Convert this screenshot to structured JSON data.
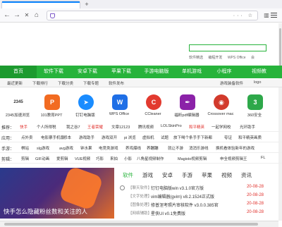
{
  "browser": {
    "new_tab_symbol": "+",
    "back": "←",
    "forward": "→",
    "close": "✕",
    "home": "⌂",
    "url_tools": "··· ☆",
    "address": ""
  },
  "search": {
    "placeholder": "",
    "links": [
      "软件精选",
      "编程开发",
      "WPS Office",
      "会"
    ]
  },
  "main_nav": [
    "首页",
    "软件下载",
    "安卓下载",
    "苹果下载",
    "手游电脑版",
    "单机游戏",
    "小程序",
    "视频教"
  ],
  "sub_nav": [
    "最近更新",
    "下载排行",
    "下载分类",
    "下载专题",
    "软件发布",
    "游戏装备软件",
    "logo"
  ],
  "apps": [
    {
      "label": "2345加速浏览",
      "icon": "2345-browser-icon",
      "glyph": "2345",
      "color": "#ffffff"
    },
    {
      "label": "101教育PPT",
      "icon": "ppt-icon",
      "glyph": "P",
      "color": "#f26b21"
    },
    {
      "label": "钉钉电脑版",
      "icon": "dingtalk-icon",
      "glyph": "➤",
      "color": "#1a8cff"
    },
    {
      "label": "WPS Office",
      "icon": "wps-icon",
      "glyph": "W",
      "color": "#1f6fe6"
    },
    {
      "label": "CCleaner",
      "icon": "ccleaner-icon",
      "glyph": "C",
      "color": "#e23a2f"
    },
    {
      "label": "福昕pdf编辑器",
      "icon": "foxit-icon",
      "glyph": "✒",
      "color": "#8b22a8"
    },
    {
      "label": "Crossover mac",
      "icon": "crossover-icon",
      "glyph": "◉",
      "color": "#d23a2c"
    },
    {
      "label": "360安全",
      "icon": "360-icon",
      "glyph": "3",
      "color": "#2ea84a"
    }
  ],
  "categories": {
    "recommend": {
      "head": "推荐：",
      "items": [
        "快手",
        "个人所得税",
        "我之谷7",
        "王者荣耀",
        "文章12123",
        "腾讯视频",
        "LOLSkinPro",
        "和平精英",
        "一起学网校",
        "光环助手"
      ]
    },
    "apps_row": {
      "head": "应用：",
      "items": [
        "点外卖",
        "电影票手机版",
        "修本",
        "游戏助手",
        "游戏双开",
        "pi 浏览",
        "虚拟机",
        "试题",
        "旅下喝个条手手下新都",
        "夸证",
        "和平精英画质"
      ]
    },
    "games_row": {
      "head": "手游：",
      "items": [
        "棋站",
        "slg游戏",
        "avg游戏",
        "钟水果",
        "电竞类游戏",
        "养鸡爆线",
        "养蹦蹦",
        "就让不游",
        "消消乐游线",
        "换机看体验新年的游戏"
      ]
    },
    "edit_row": {
      "head": "剪辑：",
      "items": [
        "剪辑",
        "GIF动画",
        "爱剪辑",
        "VUE视频",
        "巧影",
        "来拍",
        "小影",
        "八角星视频制作",
        "Magisto视频剪辑",
        "申全视频剪辑王",
        "FL"
      ]
    }
  },
  "banner": {
    "caption": "快手怎么隐藏粉丝数和关注的人"
  },
  "news": {
    "tabs": [
      "软件",
      "游戏",
      "安卓",
      "手游",
      "苹果",
      "视频",
      "资讯"
    ],
    "items": [
      {
        "cat": "【聊天软件】",
        "title": "钉钉电脑版win v3.1.0官方版",
        "date": "20-08-28"
      },
      {
        "cat": "【文字处理】",
        "title": "vim编辑器(gvim) v8.2.1524正式版",
        "date": "20-08-28"
      },
      {
        "cat": "【图像处理】",
        "title": "修普涅考照片审核软件 v3.0.0.385官",
        "date": "20-08-28"
      },
      {
        "cat": "【网络辅助】",
        "title": "星侠UI v0.1免费版",
        "date": "20-08-28"
      }
    ]
  },
  "colors": {
    "accent_green": "#27b33b",
    "date_red": "#e0302b",
    "tab_accent": "#0a84ff"
  }
}
